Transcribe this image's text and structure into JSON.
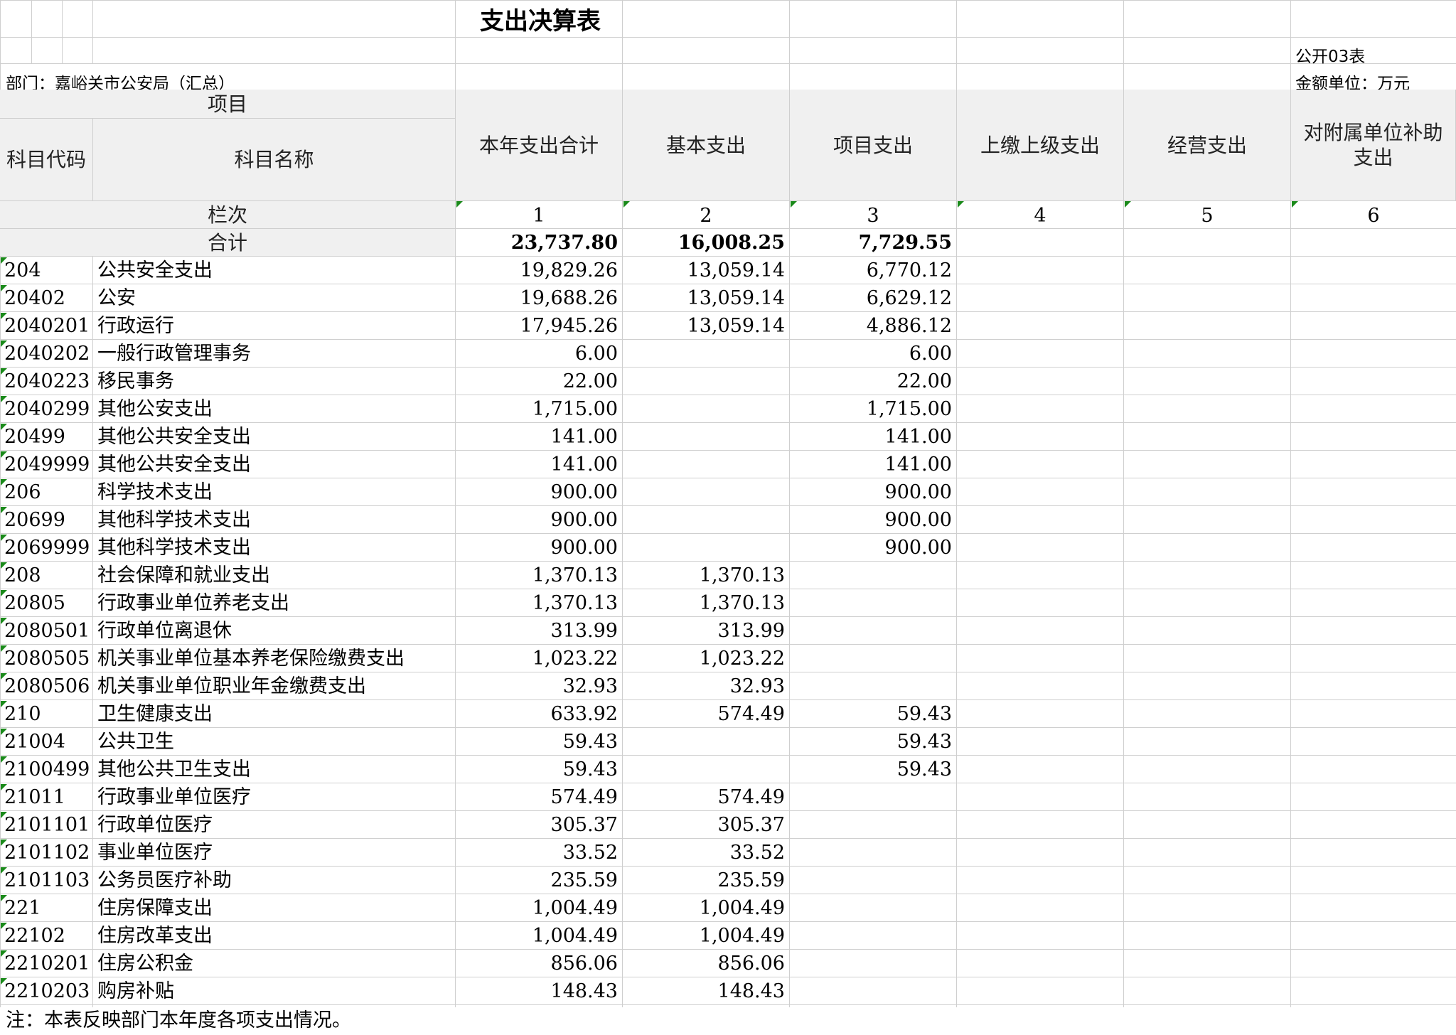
{
  "title": "支出决算表",
  "table_no": "公开03表",
  "department": "部门：嘉峪关市公安局（汇总）",
  "unit": "金额单位：万元",
  "header": {
    "item": "项目",
    "code": "科目代码",
    "name": "科目名称",
    "columns": [
      "本年支出合计",
      "基本支出",
      "项目支出",
      "上缴上级支出",
      "经营支出",
      "对附属单位补助支出"
    ],
    "column_index_label": "栏次",
    "column_numbers": [
      "1",
      "2",
      "3",
      "4",
      "5",
      "6"
    ]
  },
  "total": {
    "label": "合计",
    "values": [
      "23,737.80",
      "16,008.25",
      "7,729.55",
      "",
      "",
      ""
    ]
  },
  "rows": [
    {
      "code": "204",
      "name": "公共安全支出",
      "values": [
        "19,829.26",
        "13,059.14",
        "6,770.12",
        "",
        "",
        ""
      ]
    },
    {
      "code": "20402",
      "name": "公安",
      "values": [
        "19,688.26",
        "13,059.14",
        "6,629.12",
        "",
        "",
        ""
      ]
    },
    {
      "code": "2040201",
      "name": "行政运行",
      "values": [
        "17,945.26",
        "13,059.14",
        "4,886.12",
        "",
        "",
        ""
      ]
    },
    {
      "code": "2040202",
      "name": "一般行政管理事务",
      "values": [
        "6.00",
        "",
        "6.00",
        "",
        "",
        ""
      ]
    },
    {
      "code": "2040223",
      "name": "移民事务",
      "values": [
        "22.00",
        "",
        "22.00",
        "",
        "",
        ""
      ]
    },
    {
      "code": "2040299",
      "name": "其他公安支出",
      "values": [
        "1,715.00",
        "",
        "1,715.00",
        "",
        "",
        ""
      ]
    },
    {
      "code": "20499",
      "name": "其他公共安全支出",
      "values": [
        "141.00",
        "",
        "141.00",
        "",
        "",
        ""
      ]
    },
    {
      "code": "2049999",
      "name": "其他公共安全支出",
      "values": [
        "141.00",
        "",
        "141.00",
        "",
        "",
        ""
      ]
    },
    {
      "code": "206",
      "name": "科学技术支出",
      "values": [
        "900.00",
        "",
        "900.00",
        "",
        "",
        ""
      ]
    },
    {
      "code": "20699",
      "name": "其他科学技术支出",
      "values": [
        "900.00",
        "",
        "900.00",
        "",
        "",
        ""
      ]
    },
    {
      "code": "2069999",
      "name": "其他科学技术支出",
      "values": [
        "900.00",
        "",
        "900.00",
        "",
        "",
        ""
      ]
    },
    {
      "code": "208",
      "name": "社会保障和就业支出",
      "values": [
        "1,370.13",
        "1,370.13",
        "",
        "",
        "",
        ""
      ]
    },
    {
      "code": "20805",
      "name": "行政事业单位养老支出",
      "values": [
        "1,370.13",
        "1,370.13",
        "",
        "",
        "",
        ""
      ]
    },
    {
      "code": "2080501",
      "name": "行政单位离退休",
      "values": [
        "313.99",
        "313.99",
        "",
        "",
        "",
        ""
      ]
    },
    {
      "code": "2080505",
      "name": "机关事业单位基本养老保险缴费支出",
      "values": [
        "1,023.22",
        "1,023.22",
        "",
        "",
        "",
        ""
      ]
    },
    {
      "code": "2080506",
      "name": "机关事业单位职业年金缴费支出",
      "values": [
        "32.93",
        "32.93",
        "",
        "",
        "",
        ""
      ]
    },
    {
      "code": "210",
      "name": "卫生健康支出",
      "values": [
        "633.92",
        "574.49",
        "59.43",
        "",
        "",
        ""
      ]
    },
    {
      "code": "21004",
      "name": "公共卫生",
      "values": [
        "59.43",
        "",
        "59.43",
        "",
        "",
        ""
      ]
    },
    {
      "code": "2100499",
      "name": "其他公共卫生支出",
      "values": [
        "59.43",
        "",
        "59.43",
        "",
        "",
        ""
      ]
    },
    {
      "code": "21011",
      "name": "行政事业单位医疗",
      "values": [
        "574.49",
        "574.49",
        "",
        "",
        "",
        ""
      ]
    },
    {
      "code": "2101101",
      "name": "行政单位医疗",
      "values": [
        "305.37",
        "305.37",
        "",
        "",
        "",
        ""
      ]
    },
    {
      "code": "2101102",
      "name": "事业单位医疗",
      "values": [
        "33.52",
        "33.52",
        "",
        "",
        "",
        ""
      ]
    },
    {
      "code": "2101103",
      "name": "公务员医疗补助",
      "values": [
        "235.59",
        "235.59",
        "",
        "",
        "",
        ""
      ]
    },
    {
      "code": "221",
      "name": "住房保障支出",
      "values": [
        "1,004.49",
        "1,004.49",
        "",
        "",
        "",
        ""
      ]
    },
    {
      "code": "22102",
      "name": "住房改革支出",
      "values": [
        "1,004.49",
        "1,004.49",
        "",
        "",
        "",
        ""
      ]
    },
    {
      "code": "2210201",
      "name": "住房公积金",
      "values": [
        "856.06",
        "856.06",
        "",
        "",
        "",
        ""
      ]
    },
    {
      "code": "2210203",
      "name": "购房补贴",
      "values": [
        "148.43",
        "148.43",
        "",
        "",
        "",
        ""
      ]
    }
  ],
  "note": "注：本表反映部门本年度各项支出情况。"
}
